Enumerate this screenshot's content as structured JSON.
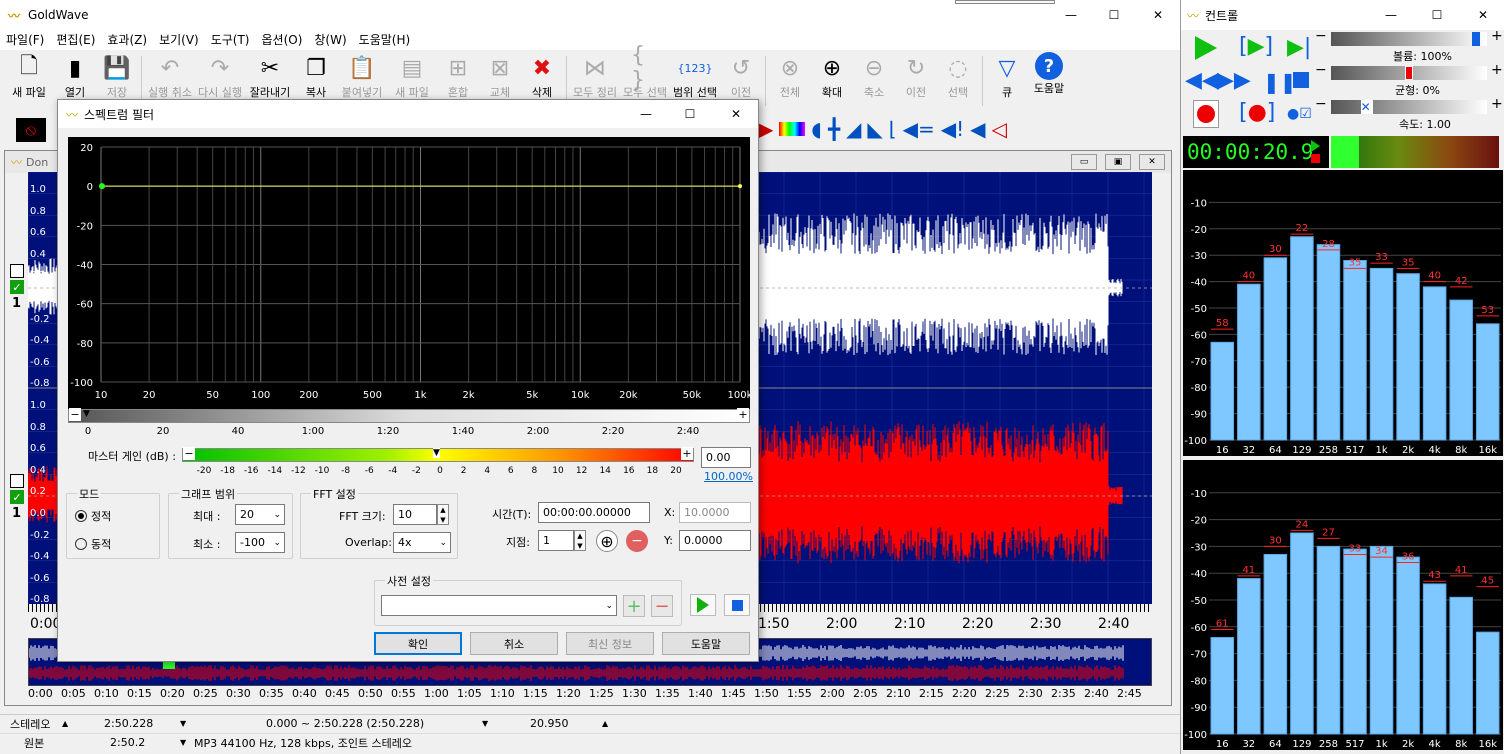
{
  "app": {
    "title": "GoldWave"
  },
  "menu": [
    "파일(F)",
    "편집(E)",
    "효과(Z)",
    "보기(V)",
    "도구(T)",
    "옵션(O)",
    "창(W)",
    "도움말(H)"
  ],
  "toolbar": [
    {
      "icon": "new-file-icon",
      "label": "새 파일",
      "enabled": true
    },
    {
      "icon": "open-icon",
      "label": "열기",
      "enabled": true
    },
    {
      "icon": "save-icon",
      "label": "저장",
      "enabled": false
    },
    {
      "icon": "undo-icon",
      "label": "실행 취소",
      "enabled": false
    },
    {
      "icon": "redo-icon",
      "label": "다시 실행",
      "enabled": false
    },
    {
      "icon": "cut-icon",
      "label": "잘라내기",
      "enabled": true
    },
    {
      "icon": "copy-icon",
      "label": "복사",
      "enabled": true
    },
    {
      "icon": "paste-icon",
      "label": "붙여넣기",
      "enabled": false
    },
    {
      "icon": "paste-new-icon",
      "label": "새 파일",
      "enabled": false
    },
    {
      "icon": "mix-icon",
      "label": "혼합",
      "enabled": false
    },
    {
      "icon": "replace-icon",
      "label": "교체",
      "enabled": false
    },
    {
      "icon": "delete-icon",
      "label": "삭제",
      "enabled": true
    },
    {
      "icon": "trim-icon",
      "label": "모두 정리",
      "enabled": false
    },
    {
      "icon": "select-all-icon",
      "label": "모두 선택",
      "enabled": false
    },
    {
      "icon": "range-select-icon",
      "label": "범위 선택",
      "enabled": true
    },
    {
      "icon": "previous-icon",
      "label": "이전",
      "enabled": false
    },
    {
      "icon": "zoom-all-icon",
      "label": "전체",
      "enabled": false
    },
    {
      "icon": "zoom-in-icon",
      "label": "확대",
      "enabled": true
    },
    {
      "icon": "zoom-out-icon",
      "label": "축소",
      "enabled": false
    },
    {
      "icon": "zoom-prev-icon",
      "label": "이전",
      "enabled": false
    },
    {
      "icon": "zoom-select-icon",
      "label": "선택",
      "enabled": false
    },
    {
      "icon": "cue-icon",
      "label": "큐",
      "enabled": true
    },
    {
      "icon": "help-icon",
      "label": "도움말",
      "enabled": true
    }
  ],
  "wave": {
    "doc_title": "Don",
    "amp_ticks": [
      "1.0",
      "0.8",
      "0.6",
      "0.4",
      "0.2",
      "0.0",
      "-0.2",
      "-0.4",
      "-0.6",
      "-0.8"
    ],
    "time_ticks_visible": [
      "1:50",
      "2:00",
      "2:10",
      "2:20",
      "2:30",
      "2:40"
    ],
    "time_start": "0:00",
    "overview_ticks": [
      "0:00",
      "0:05",
      "0:10",
      "0:15",
      "0:20",
      "0:25",
      "0:30",
      "0:35",
      "0:40",
      "0:45",
      "0:50",
      "0:55",
      "1:00",
      "1:05",
      "1:10",
      "1:15",
      "1:20",
      "1:25",
      "1:30",
      "1:35",
      "1:40",
      "1:45",
      "1:50",
      "1:55",
      "2:00",
      "2:05",
      "2:10",
      "2:15",
      "2:20",
      "2:25",
      "2:30",
      "2:35",
      "2:40",
      "2:45"
    ],
    "channel_num": "1"
  },
  "status": {
    "channels": "스테레오",
    "length": "2:50.228",
    "selection": "0.000 ~ 2:50.228 (2:50.228)",
    "position": "20.950",
    "original_label": "원본",
    "original_length": "2:50.2",
    "format": "MP3 44100 Hz, 128 kbps, 조인트 스테레오"
  },
  "dialog": {
    "title": "스펙트럼 필터",
    "y_ticks": [
      "20",
      "0",
      "-20",
      "-40",
      "-60",
      "-80",
      "-100"
    ],
    "x_ticks": [
      "10",
      "20",
      "50",
      "100",
      "200",
      "500",
      "1k",
      "2k",
      "5k",
      "10k",
      "20k",
      "50k",
      "100k"
    ],
    "time_ticks": [
      "0",
      "20",
      "40",
      "1:00",
      "1:20",
      "1:40",
      "2:00",
      "2:20",
      "2:40"
    ],
    "master_gain_label": "마스터 게인 (dB) :",
    "gain_ticks": [
      "-20",
      "-18",
      "-16",
      "-14",
      "-12",
      "-10",
      "-8",
      "-6",
      "-4",
      "-2",
      "0",
      "2",
      "4",
      "6",
      "8",
      "10",
      "12",
      "14",
      "16",
      "18",
      "20"
    ],
    "gain_value": "0.00",
    "gain_percent": "100.00%",
    "mode": {
      "label": "모드",
      "static": "정적",
      "dynamic": "동적",
      "selected": "static"
    },
    "graph_range": {
      "label": "그래프 범위",
      "max_label": "최대 :",
      "max_value": "20",
      "min_label": "최소 :",
      "min_value": "-100"
    },
    "fft": {
      "label": "FFT 설정",
      "size_label": "FFT 크기:",
      "size_value": "10",
      "overlap_label": "Overlap:",
      "overlap_value": "4x"
    },
    "time_label": "시간(T):",
    "time_value": "00:00:00.00000",
    "point_label": "지점:",
    "point_value": "1",
    "x_label": "X:",
    "x_value": "10.0000",
    "y_label": "Y:",
    "y_value": "0.0000",
    "preset_label": "사전 설정",
    "preset_value": "",
    "buttons": {
      "ok": "확인",
      "cancel": "취소",
      "latest": "최신 정보",
      "help": "도움말"
    }
  },
  "control": {
    "title": "컨트롤",
    "volume": "볼륨: 100%",
    "volume_level": 0.95,
    "balance": "균형: 0%",
    "balance_level": 0.5,
    "speed": "속도: 1.00",
    "speed_level": 0.2,
    "time_display": "00:00:20.9",
    "meter_y": [
      "-10",
      "-20",
      "-30",
      "-40",
      "-50",
      "-60",
      "-70",
      "-80",
      "-90",
      "-100"
    ],
    "meter_x": [
      "16",
      "32",
      "64",
      "129",
      "258",
      "517",
      "1k",
      "2k",
      "4k",
      "8k",
      "16k"
    ],
    "top_values": [
      -63,
      -41,
      -31,
      -23,
      -26,
      -32,
      -35,
      -37,
      -42,
      -47,
      -56
    ],
    "top_peaks": [
      "58",
      "40",
      "30",
      "22",
      "28",
      "35",
      "33",
      "35",
      "40",
      "42",
      "53"
    ],
    "top_peak_values": [
      -58,
      -40,
      -30,
      -22,
      -28,
      -35,
      -33,
      -35,
      -40,
      -42,
      -53
    ],
    "bottom_values": [
      -64,
      -42,
      -33,
      -25,
      -30,
      -31,
      -30,
      -34,
      -44,
      -49,
      -62
    ],
    "bottom_peaks": [
      "61",
      "41",
      "30",
      "24",
      "27",
      "33",
      "34",
      "36",
      "43",
      "41",
      "45"
    ],
    "bottom_peak_values": [
      -61,
      -41,
      -30,
      -24,
      -27,
      -33,
      -34,
      -36,
      -43,
      -41,
      -45
    ]
  },
  "colors": {
    "wave_bg": "#00107a",
    "left_channel": "#ffffff",
    "right_channel": "#ff0000",
    "bar": "#7ec8ff",
    "peak": "#ff2020",
    "accent": "#0078d7"
  }
}
